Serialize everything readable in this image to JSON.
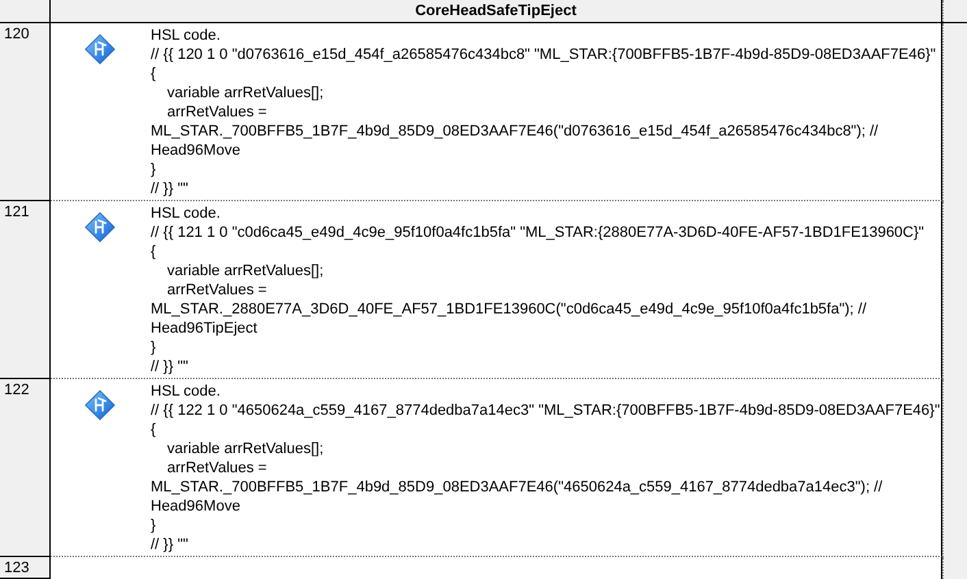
{
  "header": {
    "title": "CoreHeadSafeTipEject"
  },
  "rows": [
    {
      "number": "120",
      "kind": "step",
      "lines": [
        {
          "kind": "plain",
          "text": "HSL code."
        },
        {
          "kind": "plain",
          "text": "// {{ 120 1 0 \"d0763616_e15d_454f_a26585476c434bc8\" \"ML_STAR:{700BFFB5-1B7F-4b9d-85D9-08ED3AAF7E46}\""
        },
        {
          "kind": "plain",
          "text": "{"
        },
        {
          "kind": "indented",
          "text": "variable arrRetValues[];"
        },
        {
          "kind": "indented",
          "text": "arrRetValues ="
        },
        {
          "kind": "plain",
          "text": "ML_STAR._700BFFB5_1B7F_4b9d_85D9_08ED3AAF7E46(\"d0763616_e15d_454f_a26585476c434bc8\"); //"
        },
        {
          "kind": "plain",
          "text": "Head96Move"
        },
        {
          "kind": "plain",
          "text": "}"
        },
        {
          "kind": "plain",
          "text": "// }} \"\""
        }
      ]
    },
    {
      "number": "121",
      "kind": "step",
      "lines": [
        {
          "kind": "plain",
          "text": "HSL code."
        },
        {
          "kind": "plain",
          "text": "// {{ 121 1 0 \"c0d6ca45_e49d_4c9e_95f10f0a4fc1b5fa\" \"ML_STAR:{2880E77A-3D6D-40FE-AF57-1BD1FE13960C}\""
        },
        {
          "kind": "plain",
          "text": "{"
        },
        {
          "kind": "indented",
          "text": "variable arrRetValues[];"
        },
        {
          "kind": "indented",
          "text": "arrRetValues ="
        },
        {
          "kind": "plain",
          "text": "ML_STAR._2880E77A_3D6D_40FE_AF57_1BD1FE13960C(\"c0d6ca45_e49d_4c9e_95f10f0a4fc1b5fa\"); //"
        },
        {
          "kind": "plain",
          "text": "Head96TipEject"
        },
        {
          "kind": "plain",
          "text": "}"
        },
        {
          "kind": "plain",
          "text": "// }} \"\""
        }
      ]
    },
    {
      "number": "122",
      "kind": "step",
      "lines": [
        {
          "kind": "plain",
          "text": "HSL code."
        },
        {
          "kind": "plain",
          "text": "// {{ 122 1 0 \"4650624a_c559_4167_8774dedba7a14ec3\" \"ML_STAR:{700BFFB5-1B7F-4b9d-85D9-08ED3AAF7E46}\""
        },
        {
          "kind": "plain",
          "text": "{"
        },
        {
          "kind": "indented",
          "text": "variable arrRetValues[];"
        },
        {
          "kind": "indented",
          "text": "arrRetValues ="
        },
        {
          "kind": "plain",
          "text": "ML_STAR._700BFFB5_1B7F_4b9d_85D9_08ED3AAF7E46(\"4650624a_c559_4167_8774dedba7a14ec3\"); //"
        },
        {
          "kind": "plain",
          "text": "Head96Move"
        },
        {
          "kind": "plain",
          "text": "}"
        },
        {
          "kind": "plain",
          "text": "// }} \"\""
        }
      ]
    },
    {
      "number": "123",
      "kind": "empty"
    }
  ]
}
